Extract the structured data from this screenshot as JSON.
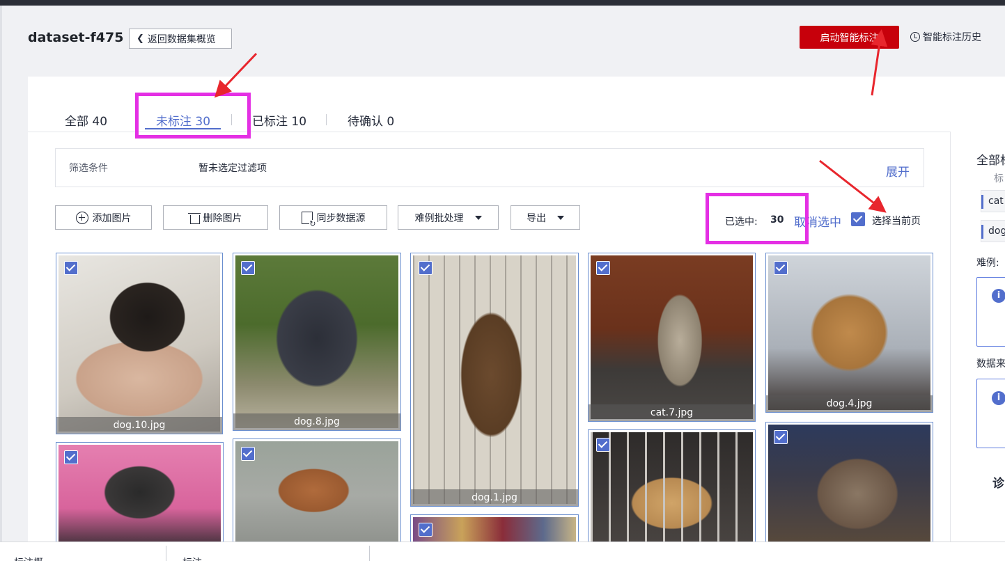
{
  "header": {
    "dataset_title": "dataset-f475",
    "back_label": "返回数据集概览",
    "start_label": "启动智能标注",
    "history_label": "智能标注历史"
  },
  "tabs": [
    {
      "label": "全部 40"
    },
    {
      "label": "未标注 30"
    },
    {
      "label": "已标注 10"
    },
    {
      "label": "待确认 0"
    }
  ],
  "filter": {
    "label": "筛选条件",
    "value": "暂未选定过滤项",
    "expand_label": "展开"
  },
  "toolbar": {
    "add_label": "添加图片",
    "delete_label": "删除图片",
    "sync_label": "同步数据源",
    "hard_label": "难例批处理",
    "export_label": "导出"
  },
  "selection": {
    "selected_label": "已选中:",
    "count": "30",
    "cancel_label": "取消选中",
    "page_label": "选择当前页"
  },
  "images": [
    {
      "name": "dog.10.jpg"
    },
    {
      "name": "dog.8.jpg"
    },
    {
      "name": "dog.1.jpg"
    },
    {
      "name": "cat.7.jpg"
    },
    {
      "name": "dog.4.jpg"
    }
  ],
  "right_panel": {
    "header": "全部标",
    "sub": "标",
    "tags": [
      "cat",
      "dog"
    ],
    "hard_label": "难例:",
    "source_label": "数据来",
    "bottom_text": "诊"
  },
  "footer": {
    "left_text": "标注概",
    "mid_text": "标注"
  },
  "colors": {
    "accent": "#526ecc",
    "brand_red": "#c7000b",
    "highlight": "#e42fe4",
    "arrow": "#e8262d"
  }
}
